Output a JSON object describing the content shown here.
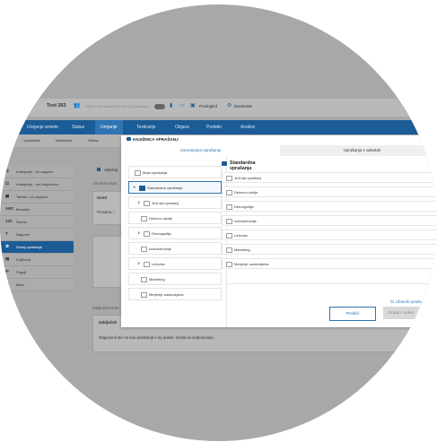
{
  "topbar": {
    "survey_title": "Test 263",
    "url": "https://1ka.si/survey/index.php?anketa=...",
    "preview_label": "Predogled",
    "settings_label": "Nastavitve"
  },
  "nav": {
    "tabs": [
      "Urejanje ankete",
      "Status",
      "Urejanje",
      "Testiranje",
      "Objava",
      "Podatki",
      "Analize"
    ],
    "active_index": 2
  },
  "subnav": {
    "items": [
      "Vprašalnik",
      "Nastavitve",
      "Oblika"
    ]
  },
  "sidebar": {
    "items": [
      {
        "icon": "☰",
        "label": "Kategorije - en odgovor"
      },
      {
        "icon": "☑",
        "label": "Kategorije - več odgovorov"
      },
      {
        "icon": "▦",
        "label": "Tabela - en odgovor"
      },
      {
        "icon": "ABC",
        "label": "Besedilo"
      },
      {
        "icon": "123",
        "label": "Število"
      },
      {
        "icon": "T",
        "label": "Nagovor"
      },
      {
        "icon": "⚙",
        "label": "Dodaj vprašanje"
      },
      {
        "icon": "▤",
        "label": "Knjižnica"
      },
      {
        "icon": "IF",
        "label": "Pogoji"
      },
      {
        "icon": "▭",
        "label": "Bloki"
      }
    ],
    "active_index": 6
  },
  "background": {
    "activate_label": "Aktiviraj",
    "intro_short": "Uvod",
    "intro_text": "Prosimo, i",
    "above_label": "Uvodna stran",
    "closing_area_label": "Zaključna stran",
    "closing_title": "Zaključek",
    "closing_text": "Odgovorili ste na vsa vprašanja v tej anketi. Hvala za sodelovanje."
  },
  "modal": {
    "title": "KNJIŽNICA VPRAŠANJ",
    "tabs": [
      {
        "label": "Samostojna vprašanja",
        "active": true
      },
      {
        "label": "Vprašanja v anketah",
        "active": false
      }
    ],
    "tree": [
      {
        "chevron": "",
        "label": "Moja vprašanja",
        "indent": 0,
        "selected": false
      },
      {
        "chevron": "∧",
        "label": "Standardna vprašanja",
        "indent": 0,
        "selected": true
      },
      {
        "chevron": "∨",
        "label": "1KA tipi vprašanj",
        "indent": 1,
        "selected": false
      },
      {
        "chevron": "",
        "label": "Delovno okolje",
        "indent": 1,
        "selected": false
      },
      {
        "chevron": "∨",
        "label": "Demografija",
        "indent": 1,
        "selected": false
      },
      {
        "chevron": "",
        "label": "Izobraževanje",
        "indent": 1,
        "selected": false
      },
      {
        "chevron": "∨",
        "label": "Letovice",
        "indent": 1,
        "selected": false
      },
      {
        "chevron": "",
        "label": "Marketing",
        "indent": 1,
        "selected": false
      },
      {
        "chevron": "",
        "label": "Merjenje zadovoljstva",
        "indent": 1,
        "selected": false
      }
    ],
    "content": {
      "title": "Standardna vprašanja",
      "items": [
        "1KA tipi vprašanj",
        "Delovno okolje",
        "Demografija",
        "Izobraževanje",
        "Letovice",
        "Marketing",
        "Merjenje zadovoljstva"
      ]
    },
    "selected_count_label": "Št. izbranih vpraša",
    "cancel_label": "Prekliči",
    "add_label": "Dodaj v anket"
  },
  "colors": {
    "brand": "#1c5c96",
    "accent": "#2f74b3",
    "overlay": "#a8a8a8"
  }
}
